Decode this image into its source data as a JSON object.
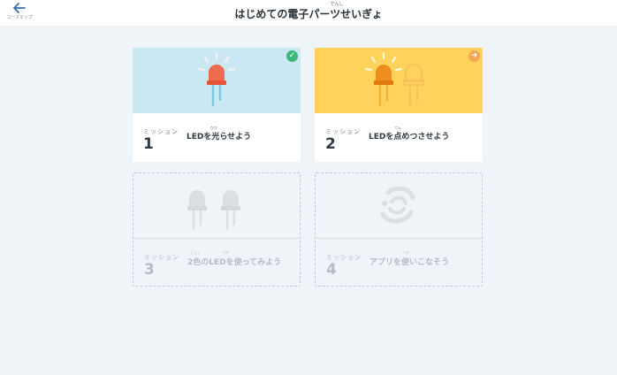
{
  "header": {
    "back_label": "コースマップ",
    "title_ruby": "でんし",
    "title": "はじめての電子パーツせいぎょ"
  },
  "missions": [
    {
      "label": "ミッション",
      "number": "1",
      "ruby": "ひか",
      "text": "LEDを光らせよう",
      "status": "done",
      "banner_color": "#c9e8f4"
    },
    {
      "label": "ミッション",
      "number": "2",
      "ruby": "てん",
      "text": "LEDを点めつさせよう",
      "status": "next",
      "banner_color": "#ffd35b"
    },
    {
      "label": "ミッション",
      "number": "3",
      "ruby": "しょく　　　　　　つか",
      "text": "2色のLEDを使ってみよう",
      "status": "locked"
    },
    {
      "label": "ミッション",
      "number": "4",
      "ruby": "つか",
      "text": "アプリを使いこなそう",
      "status": "locked"
    }
  ],
  "colors": {
    "background": "#eef4f7",
    "done": "#3cb878",
    "next": "#f3a653",
    "red_led": "#ee6b4d",
    "orange_led": "#f08d1f"
  },
  "icons": {
    "back": "arrow-left-icon",
    "done": "check-circle-icon",
    "next": "arrow-right-circle-icon"
  }
}
